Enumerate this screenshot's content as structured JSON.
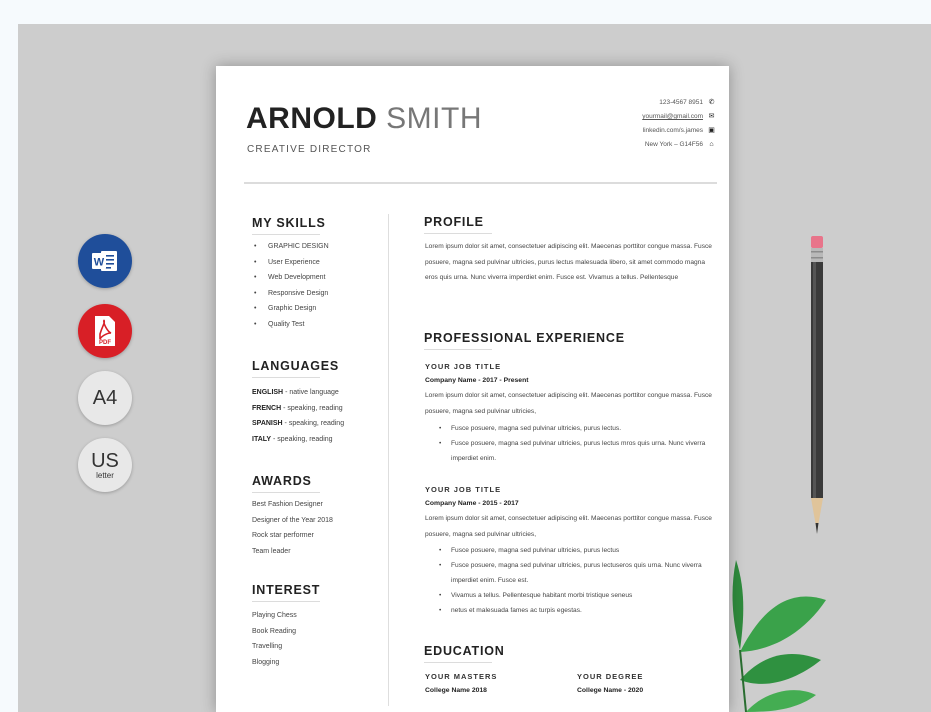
{
  "badges": {
    "word_icon": "word-icon",
    "pdf_icon": "pdf-icon",
    "pdf_text": "PDF",
    "a4": "A4",
    "us": "US",
    "us_sub": "letter"
  },
  "header": {
    "first_name": "ARNOLD",
    "last_name": "SMITH",
    "title": "CREATIVE DIRECTOR",
    "contacts": [
      {
        "text": "123-4567 8951",
        "icon": "phone-icon"
      },
      {
        "text": "yourmail@gmail.com",
        "icon": "mail-icon"
      },
      {
        "text": "linkedin.com/s.james",
        "icon": "linkedin-icon"
      },
      {
        "text": "New York – G14F56",
        "icon": "home-icon"
      }
    ]
  },
  "sidebar": {
    "skills_title": "MY SKILLS",
    "skills": [
      "GRAPHIC DESIGN",
      "User Experience",
      "Web Development",
      "Responsive Design",
      "Graphic Design",
      "Quality Test"
    ],
    "languages_title": "LANGUAGES",
    "languages": [
      {
        "name": "ENGLISH",
        "level": " - native language"
      },
      {
        "name": "FRENCH",
        "level": " - speaking, reading"
      },
      {
        "name": "SPANISH",
        "level": " - speaking, reading"
      },
      {
        "name": "ITALY",
        "level": " - speaking, reading"
      }
    ],
    "awards_title": "AWARDS",
    "awards": [
      "Best Fashion Designer",
      "Designer of the Year 2018",
      "Rock star performer",
      "Team leader"
    ],
    "interest_title": "INTEREST",
    "interests": [
      "Playing Chess",
      "Book Reading",
      "Travelling",
      "Blogging"
    ]
  },
  "main": {
    "profile_title": "PROFILE",
    "profile_text": "Lorem ipsum dolor sit amet, consectetuer adipiscing elit. Maecenas porttitor congue massa. Fusce posuere, magna sed pulvinar ultricies, purus lectus malesuada libero, sit amet commodo magna eros quis urna. Nunc viverra imperdiet enim. Fusce est. Vivamus a tellus. Pellentesque",
    "experience_title": "PROFESSIONAL EXPERIENCE",
    "jobs": [
      {
        "title": "YOUR JOB TITLE",
        "company": "Company Name  - 2017 - Present",
        "desc": "Lorem ipsum dolor sit amet, consectetuer adipiscing elit. Maecenas porttitor congue massa. Fusce posuere, magna sed pulvinar ultricies,",
        "bullets": [
          "Fusce posuere, magna sed pulvinar ultricies, purus lectus.",
          "Fusce posuere, magna sed pulvinar ultricies, purus lectus mros quis urna. Nunc viverra imperdiet enim."
        ]
      },
      {
        "title": "YOUR JOB TITLE",
        "company": "Company Name  - 2015 - 2017",
        "desc": "Lorem ipsum dolor sit amet, consectetuer adipiscing elit. Maecenas porttitor congue massa. Fusce posuere, magna sed pulvinar ultricies,",
        "bullets": [
          "Fusce posuere, magna sed pulvinar ultricies, purus lectus",
          "Fusce posuere, magna sed pulvinar ultricies, purus lectuseros quis urna. Nunc viverra imperdiet enim. Fusce est.",
          "Vivamus a tellus. Pellentesque habitant morbi tristique seneus",
          "netus et malesuada fames ac turpis egestas."
        ]
      }
    ],
    "education_title": "EDUCATION",
    "education": [
      {
        "degree": "YOUR MASTERS",
        "school": "College Name  2018"
      },
      {
        "degree": "YOUR DEGREE",
        "school": "College Name - 2020"
      }
    ]
  }
}
